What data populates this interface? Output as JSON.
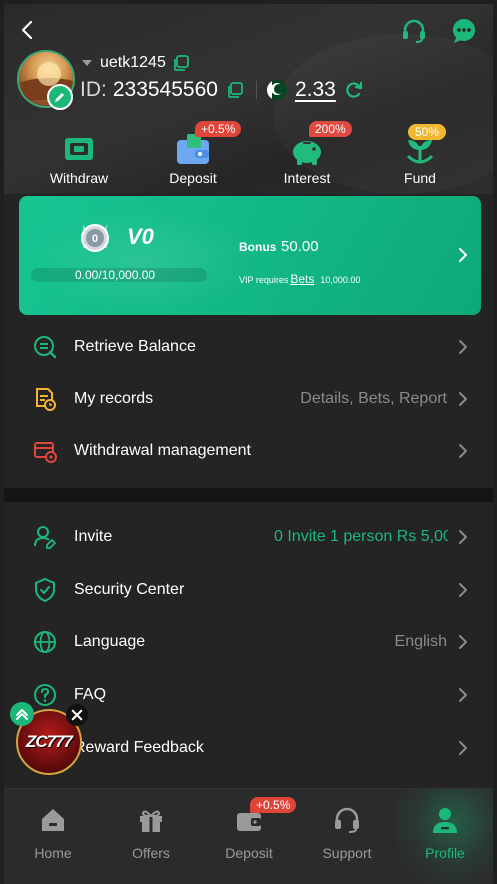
{
  "header": {
    "username": "uetk1245",
    "id_label": "ID:",
    "id_value": "233545560",
    "balance": "2.33"
  },
  "quick_actions": [
    {
      "label": "Withdraw",
      "badge": ""
    },
    {
      "label": "Deposit",
      "badge": "+0.5%"
    },
    {
      "label": "Interest",
      "badge": "200%"
    },
    {
      "label": "Fund",
      "badge": "50%"
    }
  ],
  "vip": {
    "medal_level": "0",
    "level": "V0",
    "progress_text": "0.00/10,000.00",
    "progress_fraction": 0,
    "bonus_label": "Bonus",
    "bonus_value": "50.00",
    "requires_text": "VIP requires",
    "bets_link": "Bets",
    "requires_amount": "10,000.00"
  },
  "menu_group1": [
    {
      "label": "Retrieve Balance",
      "extra": ""
    },
    {
      "label": "My records",
      "extra": "Details, Bets, Report"
    },
    {
      "label": "Withdrawal management",
      "extra": ""
    }
  ],
  "menu_group2": [
    {
      "label": "Invite",
      "extra": "0  Invite 1 person Rs 5,00"
    },
    {
      "label": "Security Center",
      "extra": ""
    },
    {
      "label": "Language",
      "extra": "English"
    },
    {
      "label": "FAQ",
      "extra": ""
    },
    {
      "label": "Reward Feedback",
      "extra": ""
    }
  ],
  "floating_ad": {
    "text": "ZC777"
  },
  "bottom_nav": [
    {
      "label": "Home",
      "badge": ""
    },
    {
      "label": "Offers",
      "badge": ""
    },
    {
      "label": "Deposit",
      "badge": "+0.5%"
    },
    {
      "label": "Support",
      "badge": ""
    },
    {
      "label": "Profile",
      "badge": ""
    }
  ],
  "colors": {
    "accent": "#1cb87a",
    "badge_red": "#e0453a",
    "badge_yellow": "#f2b52c",
    "background": "#242424"
  }
}
